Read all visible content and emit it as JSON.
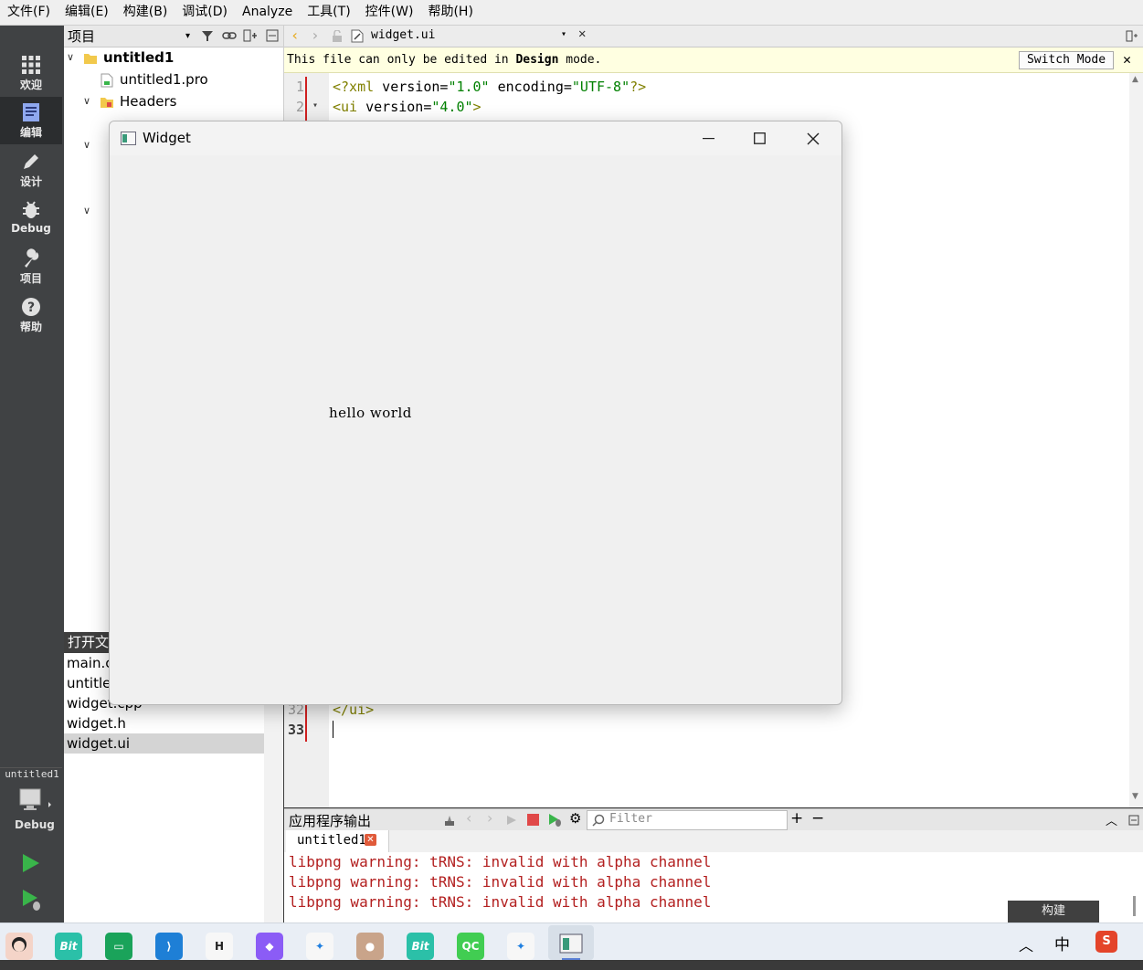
{
  "menubar": {
    "items": [
      "文件(F)",
      "编辑(E)",
      "构建(B)",
      "调试(D)",
      "Analyze",
      "工具(T)",
      "控件(W)",
      "帮助(H)"
    ]
  },
  "modebar": {
    "modes": [
      {
        "label": "欢迎",
        "icon": "grid-icon"
      },
      {
        "label": "编辑",
        "icon": "document-icon"
      },
      {
        "label": "设计",
        "icon": "pencil-icon"
      },
      {
        "label": "Debug",
        "icon": "bug-icon"
      },
      {
        "label": "项目",
        "icon": "wrench-icon"
      },
      {
        "label": "帮助",
        "icon": "help-icon"
      }
    ],
    "kit_project": "untitled1",
    "kit_mode": "Debug"
  },
  "project": {
    "header": "项目",
    "tree": {
      "root": "untitled1",
      "pro_file": "untitled1.pro",
      "headers": "Headers"
    }
  },
  "open_docs": {
    "header": "打开文",
    "files": [
      "main.c",
      "untitle",
      "widget.cpp",
      "widget.h",
      "widget.ui"
    ],
    "selected": "widget.ui"
  },
  "editor": {
    "filename": "widget.ui",
    "info_text_pre": "This file can only be edited in ",
    "info_text_bold": "Design",
    "info_text_post": " mode.",
    "switch_mode_label": "Switch Mode",
    "lines": [
      {
        "num": "1",
        "tag": "<?xml",
        "rest_attr": " version=",
        "val1": "\"1.0\"",
        "attr2": " encoding=",
        "val2": "\"UTF-8\"",
        "end": "?>"
      },
      {
        "num": "2",
        "tag": "<ui",
        "rest_attr": " version=",
        "val1": "\"4.0\"",
        "end": ">"
      }
    ],
    "line32_num": "32",
    "line32_code": "</ui>",
    "line33_num": "33"
  },
  "output": {
    "title": "应用程序输出",
    "filter_placeholder": "Filter",
    "tab": "untitled1",
    "lines": [
      "libpng warning: tRNS: invalid with alpha channel",
      "libpng warning: tRNS: invalid with alpha channel",
      "libpng warning: tRNS: invalid with alpha channel"
    ],
    "build_label": "构建"
  },
  "widget_window": {
    "title": "Widget",
    "label": "hello world"
  },
  "taskbar": {
    "ime": "中"
  },
  "colors": {
    "accent": "#5a7fd4",
    "run_green": "#39b54a",
    "stop_red": "#e04848",
    "xml_tag": "#808000",
    "xml_value": "#008000",
    "output_error": "#b32020"
  }
}
